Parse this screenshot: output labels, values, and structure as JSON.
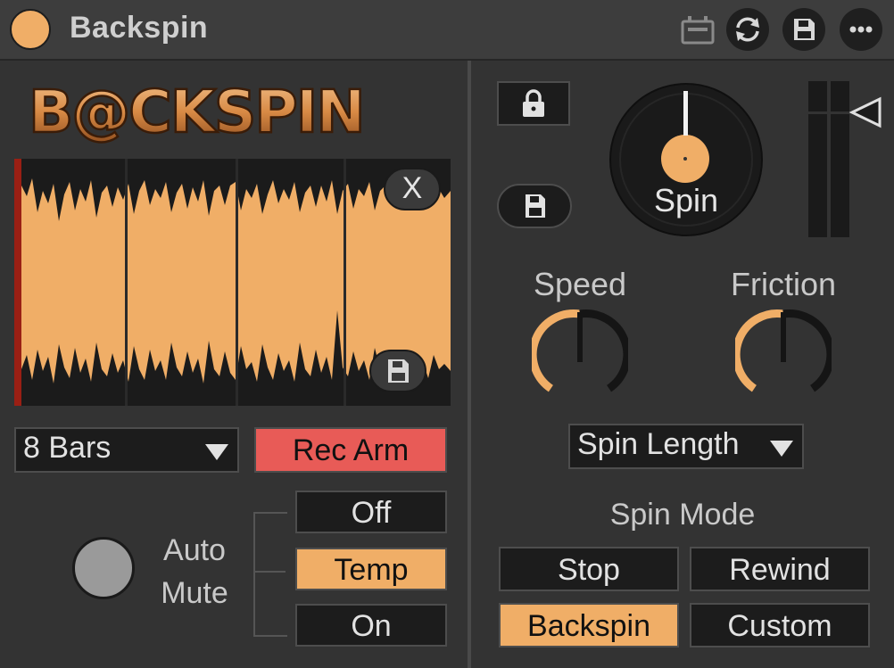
{
  "title": "Backspin",
  "logo_text": "B@CKSPIN",
  "waveform": {
    "clear_label": "X"
  },
  "bars_dropdown": {
    "value": "8 Bars"
  },
  "rec_arm_label": "Rec Arm",
  "auto_mute": {
    "label_line1": "Auto",
    "label_line2": "Mute",
    "options": [
      "Off",
      "Temp",
      "On"
    ],
    "selected": "Temp"
  },
  "spin": {
    "label": "Spin"
  },
  "speed": {
    "label": "Speed",
    "value": 0.5
  },
  "friction": {
    "label": "Friction",
    "value": 0.5
  },
  "spin_length_dropdown": {
    "value": "Spin Length"
  },
  "spin_mode": {
    "label": "Spin Mode",
    "options": [
      "Stop",
      "Rewind",
      "Backspin",
      "Custom"
    ],
    "selected": "Backspin"
  },
  "colors": {
    "accent": "#f0ae67",
    "rec": "#e85b57",
    "panel": "#333333"
  },
  "icons": [
    "power-icon",
    "midi-map-icon",
    "hot-swap-icon",
    "save-icon",
    "more-icon",
    "lock-icon",
    "save-icon",
    "save-icon"
  ]
}
